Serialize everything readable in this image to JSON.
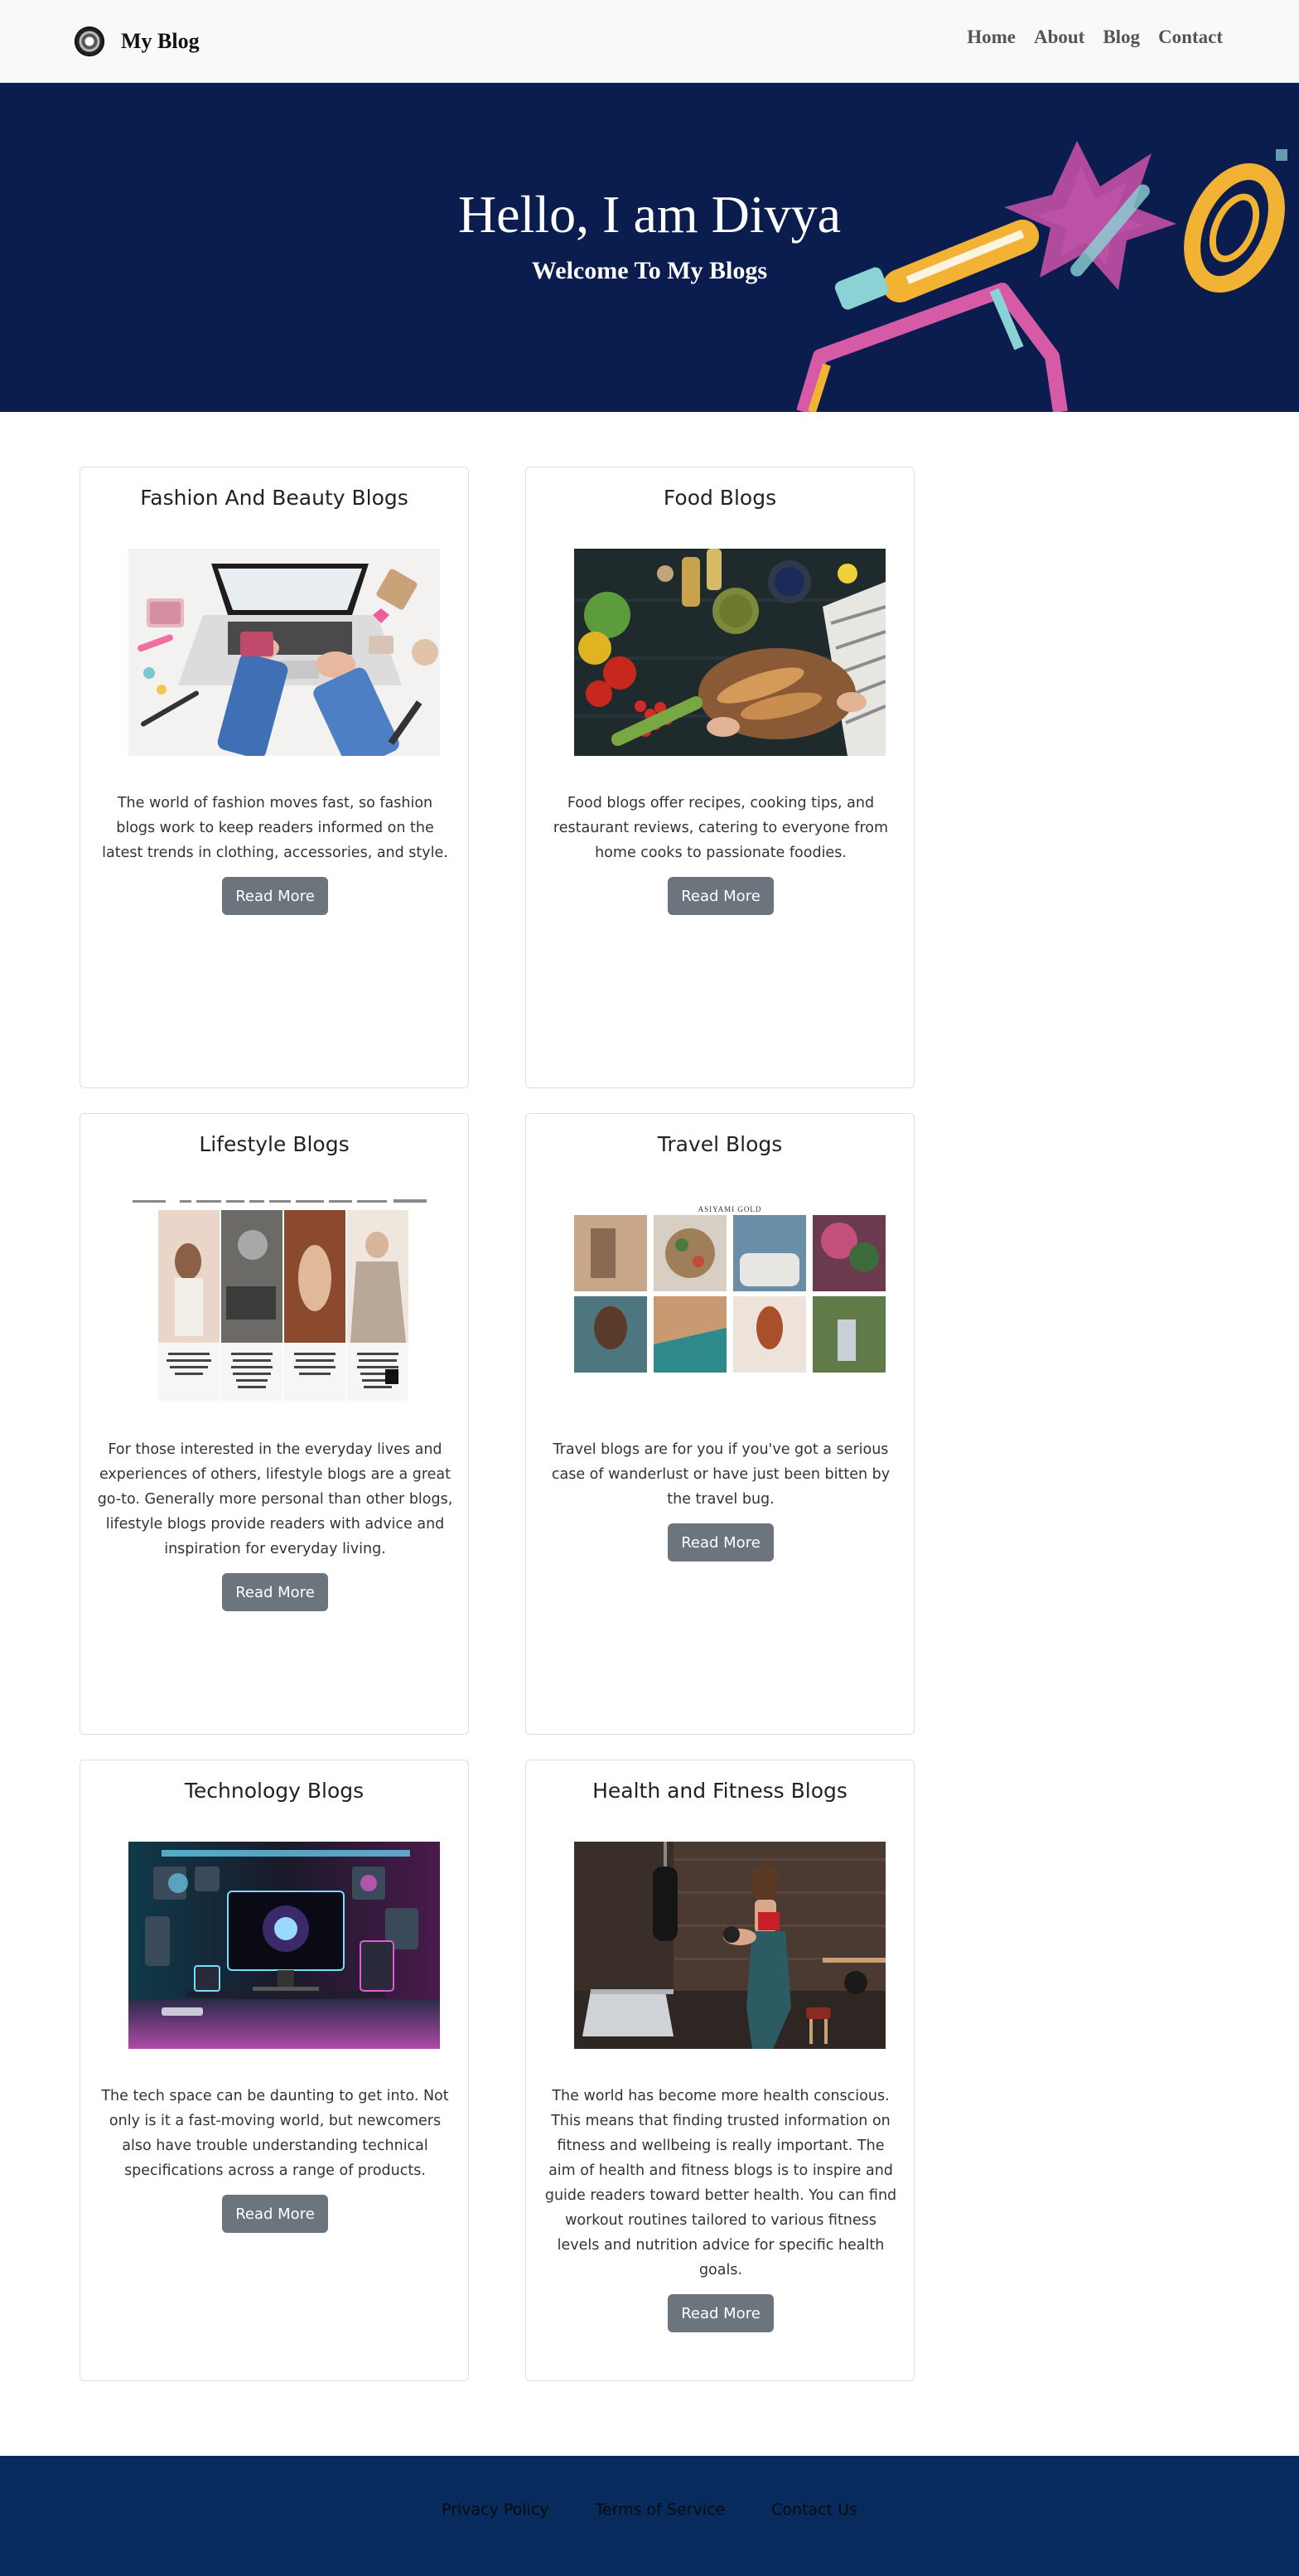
{
  "navbar": {
    "brand": "My Blog",
    "links": [
      "Home",
      "About",
      "Blog",
      "Contact"
    ]
  },
  "hero": {
    "title": "Hello, I am Divya",
    "subtitle": "Welcome To My Blogs"
  },
  "cards": [
    {
      "title": "Fashion And Beauty Blogs",
      "image": "laptop-fashion-flatlay-image",
      "text": "The world of fashion moves fast, so fashion blogs work to keep readers informed on the latest trends in clothing, accessories, and style.",
      "button": "Read More"
    },
    {
      "title": "Food Blogs",
      "image": "food-table-bread-vegetables-image",
      "text": "Food blogs offer recipes, cooking tips, and restaurant reviews, catering to everyone from home cooks to passionate foodies.",
      "button": "Read More"
    },
    {
      "title": "Lifestyle Blogs",
      "image": "lifestyle-website-screenshot-image",
      "text": "For those interested in the everyday lives and experiences of others, lifestyle blogs are a great go-to. Generally more personal than other blogs, lifestyle blogs provide readers with advice and inspiration for everyday living.",
      "button": "Read More"
    },
    {
      "title": "Travel Blogs",
      "image": "travel-instagram-grid-image",
      "image_caption": "ASIYAMI GOLD",
      "text": "Travel blogs are for you if you've got a serious case of wanderlust or have just been bitten by the travel bug.",
      "button": "Read More"
    },
    {
      "title": "Technology Blogs",
      "image": "neon-tech-setup-image",
      "text": "The tech space can be daunting to get into. Not only is it a fast-moving world, but newcomers also have trouble understanding technical specifications across a range of products.",
      "button": "Read More"
    },
    {
      "title": "Health and Fitness Blogs",
      "image": "woman-gym-fitness-image",
      "text": "The world has become more health conscious. This means that finding trusted information on fitness and wellbeing is really important. The aim of health and fitness blogs is to inspire and guide readers toward better health. You can find workout routines tailored to various fitness levels and nutrition advice for specific health goals.",
      "button": "Read More"
    }
  ],
  "footer": {
    "links": [
      "Privacy Policy",
      "Terms of Service",
      "Contact Us"
    ]
  },
  "colors": {
    "navbar_bg": "#f8f9fa",
    "hero_bg": "#0b1d4e",
    "button_bg": "#6c757d",
    "footer_bg": "#062b5c"
  }
}
